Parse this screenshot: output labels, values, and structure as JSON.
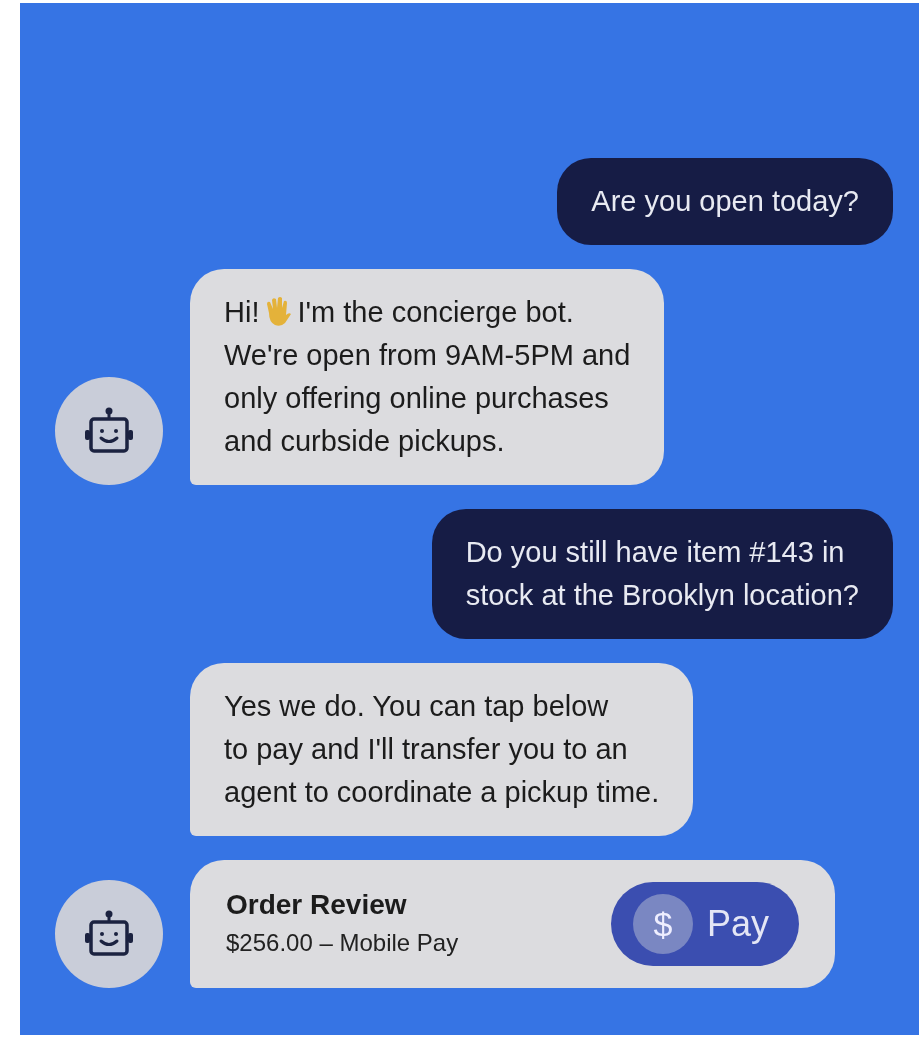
{
  "messages": [
    {
      "kind": "user",
      "lines": [
        "Are you open today?"
      ]
    },
    {
      "kind": "bot",
      "greeting": "Hi!",
      "first": "I'm the concierge bot.",
      "lines": [
        "We're open from 9AM-5PM and",
        "only offering online purchases",
        "and curbside pickups."
      ],
      "avatar": true
    },
    {
      "kind": "user",
      "lines": [
        "Do you still have item #143 in",
        "stock at the Brooklyn location?"
      ]
    },
    {
      "kind": "bot",
      "lines": [
        "Yes we do. You can tap below",
        "to pay and I'll transfer you to an",
        "agent to coordinate a pickup time."
      ],
      "avatar": false
    },
    {
      "kind": "card",
      "title": "Order Review",
      "subtitle": "$256.00 – Mobile Pay",
      "button": {
        "icon": "$",
        "label": "Pay"
      },
      "avatar": true
    }
  ]
}
